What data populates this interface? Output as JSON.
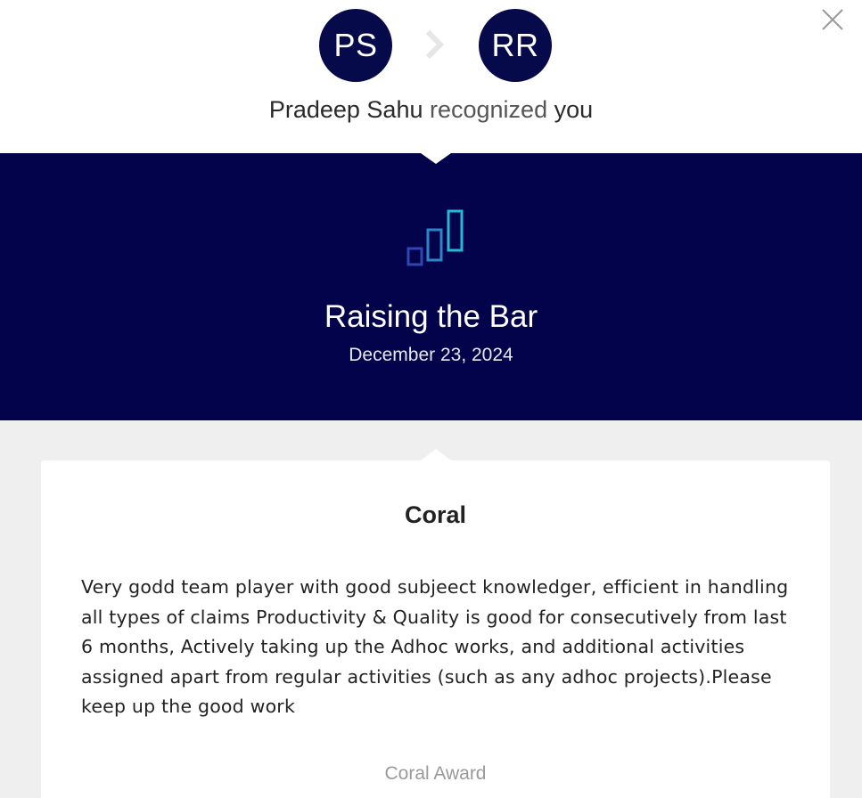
{
  "sender": {
    "initials": "PS",
    "name": "Pradeep Sahu"
  },
  "receiver": {
    "initials": "RR",
    "pronoun": "you"
  },
  "headline": {
    "verb": "recognized"
  },
  "icons": {
    "close": "close-icon",
    "arrow": "chevron-right-icon",
    "award": "bar-chart-icon"
  },
  "award": {
    "title": "Raising the Bar",
    "date": "December 23, 2024"
  },
  "card": {
    "title": "Coral",
    "message": "Very godd team player with good subjeect knowledger, efficient in handling all types of claims Productivity & Quality is good for consecutively from last 6 months, Actively taking up the Adhoc works, and additional activities assigned apart from regular activities (such as any adhoc projects).Please keep up the good work",
    "award_type": "Coral Award"
  },
  "colors": {
    "navy": "#02034a",
    "avatar": "#070a4a",
    "panel_bg": "#efefef",
    "icon_teal": "#27b3d4",
    "icon_blue": "#2f5fb8"
  }
}
